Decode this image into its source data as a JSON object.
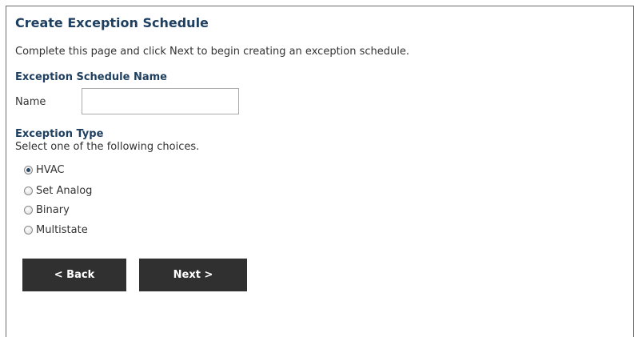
{
  "page": {
    "title": "Create Exception Schedule",
    "intro": "Complete this page and click Next to begin creating an exception schedule."
  },
  "name_section": {
    "heading": "Exception Schedule Name",
    "label": "Name",
    "value": "",
    "placeholder": ""
  },
  "type_section": {
    "heading": "Exception Type",
    "help": "Select one of the following choices.",
    "options": [
      {
        "label": "HVAC",
        "selected": true
      },
      {
        "label": "Set Analog",
        "selected": false
      },
      {
        "label": "Binary",
        "selected": false
      },
      {
        "label": "Multistate",
        "selected": false
      }
    ]
  },
  "buttons": {
    "back_label": "< Back",
    "next_label": "Next >"
  },
  "colors": {
    "heading": "#1f3f60",
    "button_bg": "#303030",
    "button_text": "#ffffff",
    "frame_border": "#6a6a6a"
  }
}
